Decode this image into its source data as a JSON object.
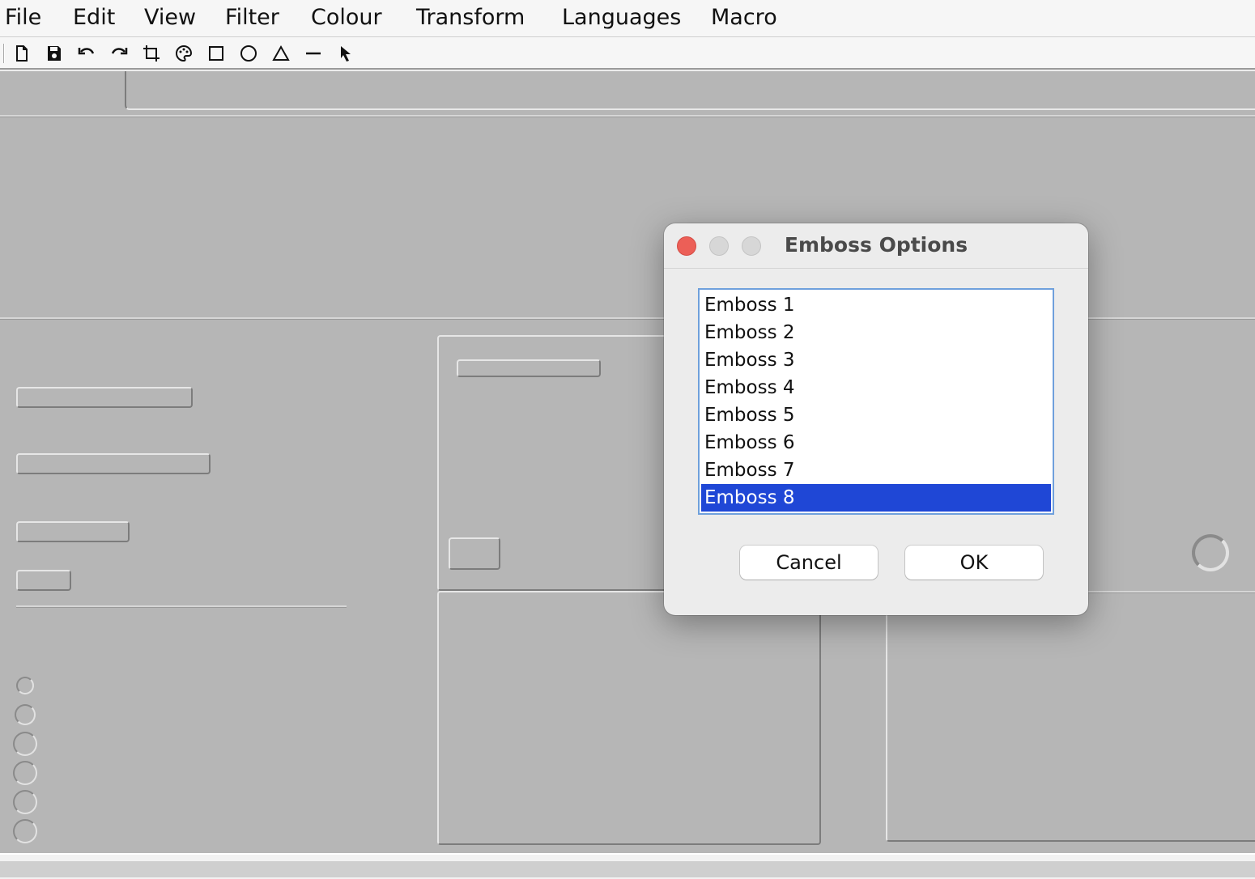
{
  "menu": {
    "items": [
      "File",
      "Edit",
      "View",
      "Filter",
      "Colour",
      "Transform",
      "Languages",
      "Macro"
    ]
  },
  "toolbar": {
    "tools": [
      "new-file-icon",
      "save-icon",
      "undo-icon",
      "redo-icon",
      "crop-icon",
      "palette-icon",
      "rectangle-icon",
      "circle-icon",
      "triangle-icon",
      "line-icon",
      "pointer-icon"
    ]
  },
  "dialog": {
    "title": "Emboss Options",
    "options": [
      "Emboss 1",
      "Emboss 2",
      "Emboss 3",
      "Emboss 4",
      "Emboss 5",
      "Emboss 6",
      "Emboss 7",
      "Emboss 8"
    ],
    "selected": "Emboss 8",
    "cancel_label": "Cancel",
    "ok_label": "OK"
  },
  "colors": {
    "selection": "#1f47d6",
    "close_button": "#ec5f57",
    "canvas": "#b6b6b6"
  }
}
